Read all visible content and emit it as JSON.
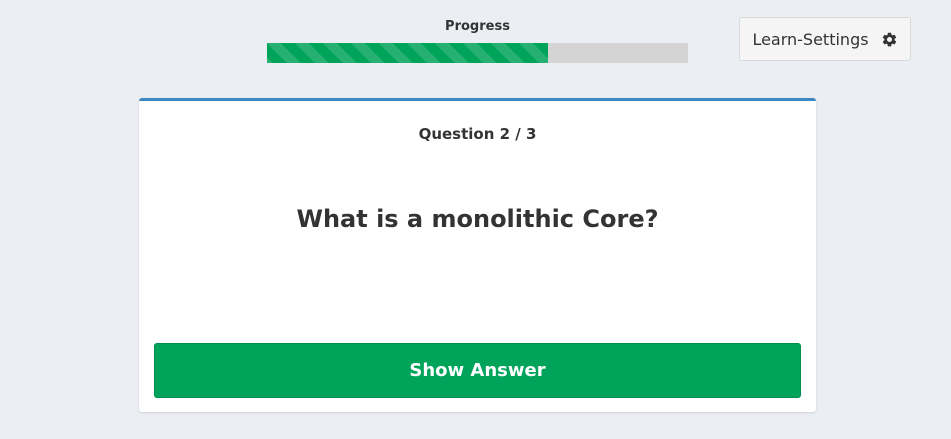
{
  "progress": {
    "label": "Progress",
    "fraction": 0.667
  },
  "settings": {
    "label": "Learn-Settings",
    "icon": "gear-icon"
  },
  "card": {
    "counter": "Question 2 / 3",
    "question": "What is a monolithic Core?",
    "show_answer_label": "Show Answer"
  },
  "colors": {
    "background": "#ebeef3",
    "accent_green": "#00a35a",
    "card_border_blue": "#3e87c2",
    "progress_track": "#d4d4d4"
  }
}
